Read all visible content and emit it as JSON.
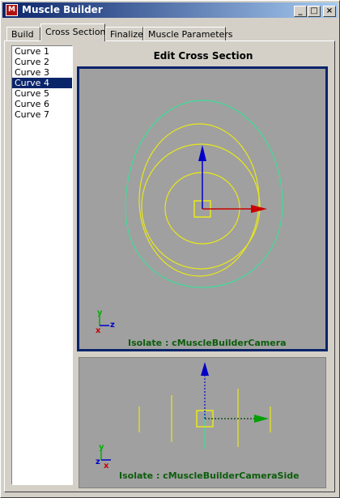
{
  "window": {
    "title": "Muscle Builder",
    "controls": [
      "_",
      "□",
      "×"
    ]
  },
  "tabs": [
    {
      "label": "Build",
      "active": false
    },
    {
      "label": "Cross Section",
      "active": true
    },
    {
      "label": "Finalize",
      "active": false
    },
    {
      "label": "Muscle Parameters",
      "active": false
    }
  ],
  "curves": [
    "Curve 1",
    "Curve 2",
    "Curve 3",
    "Curve 4",
    "Curve 5",
    "Curve 6",
    "Curve 7"
  ],
  "selected_curve": "Curve 4",
  "editor": {
    "title": "Edit Cross Section",
    "main_view": {
      "label": "Isolate : cMuscleBuilderCamera",
      "axis_labels": {
        "y": "y",
        "z": "z",
        "x": "x"
      }
    },
    "side_view": {
      "label": "Isolate : cMuscleBuilderCameraSide",
      "axis_labels": {
        "y": "y",
        "z": "z",
        "x": "x"
      }
    }
  },
  "colors": {
    "viewport_bg": "#a0a0a0",
    "selection": "#0a246a",
    "curve_yellow": "#e8e81a",
    "curve_cyan": "#3fdc9a",
    "manip_blue": "#0000c8",
    "manip_red": "#c80000",
    "manip_green": "#00a000",
    "label_green": "#0b5d0b"
  }
}
